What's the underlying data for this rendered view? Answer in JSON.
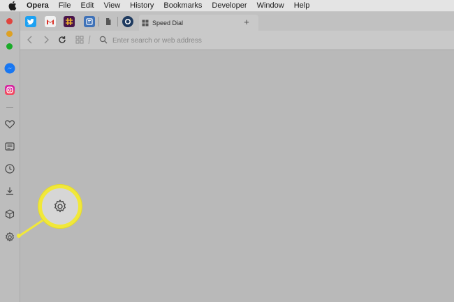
{
  "menubar": {
    "apple_icon": "apple-icon",
    "items": [
      "Opera",
      "File",
      "Edit",
      "View",
      "History",
      "Bookmarks",
      "Developer",
      "Window",
      "Help"
    ]
  },
  "window": {
    "traffic_lights": [
      "close",
      "minimize",
      "zoom"
    ],
    "colors": {
      "close": "#e0443e",
      "minimize": "#dea123",
      "zoom": "#1aab29"
    }
  },
  "sidebar": {
    "icons": [
      "messenger-icon",
      "instagram-icon",
      "heart-icon",
      "news-icon",
      "history-icon",
      "downloads-icon",
      "extensions-icon",
      "settings-icon"
    ]
  },
  "tabs": {
    "pinned": [
      "twitter-icon",
      "gmail-icon",
      "slack-icon",
      "feedly-icon",
      "document-icon",
      "opera-icon"
    ],
    "active": {
      "label": "Speed Dial",
      "icon": "speed-dial-icon"
    },
    "new_tab": "+"
  },
  "addressbar": {
    "placeholder": "Enter search or web address",
    "value": ""
  },
  "callout": {
    "highlight_color": "#f1e839",
    "icon": "settings-icon"
  }
}
